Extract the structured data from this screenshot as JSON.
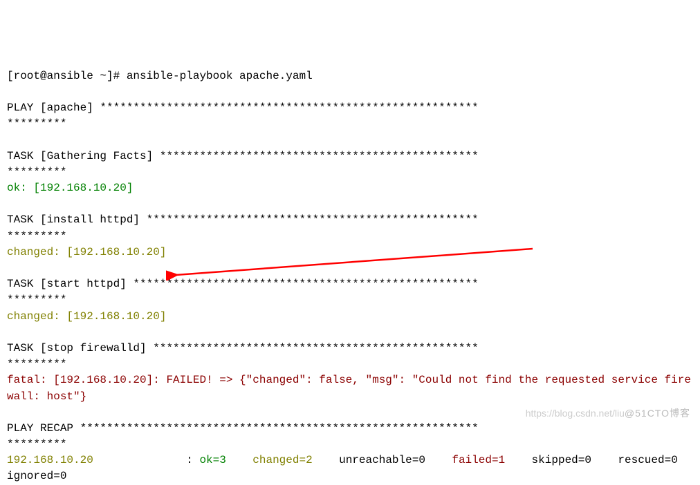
{
  "prompt": "[root@ansible ~]# ansible-playbook apache.yaml",
  "play_header": "PLAY [apache] *********************************************************",
  "play_header_wrap": "*********",
  "task_gather": "TASK [Gathering Facts] ************************************************",
  "task_gather_wrap": "*********",
  "gather_result": "ok: [192.168.10.20]",
  "task_install": "TASK [install httpd] **************************************************",
  "task_install_wrap": "*********",
  "install_result": "changed: [192.168.10.20]",
  "task_start": "TASK [start httpd] ****************************************************",
  "task_start_wrap": "*********",
  "start_result": "changed: [192.168.10.20]",
  "task_stop_a": "TASK [stop firewalld] ",
  "task_stop_b": "*************************************************",
  "task_stop_wrap": "*********",
  "stop_result": "fatal: [192.168.10.20]: FAILED! => {\"changed\": false, \"msg\": \"Could not find the requested service firewall: host\"}",
  "recap_header": "PLAY RECAP ************************************************************",
  "recap_header_wrap": "*********",
  "recap_host": "192.168.10.20",
  "recap_pad1": "              : ",
  "recap_ok": "ok=3   ",
  "recap_changed": " changed=2   ",
  "recap_unreach": " unreachable=0   ",
  "recap_failed": " failed=1   ",
  "recap_skipped": " skipped=0   ",
  "recap_rescued": " rescued=0   ",
  "recap_ignored": " ignored=0",
  "watermark_left": "https://blog.csdn.net/liu",
  "watermark_right": "@51CTO博客"
}
